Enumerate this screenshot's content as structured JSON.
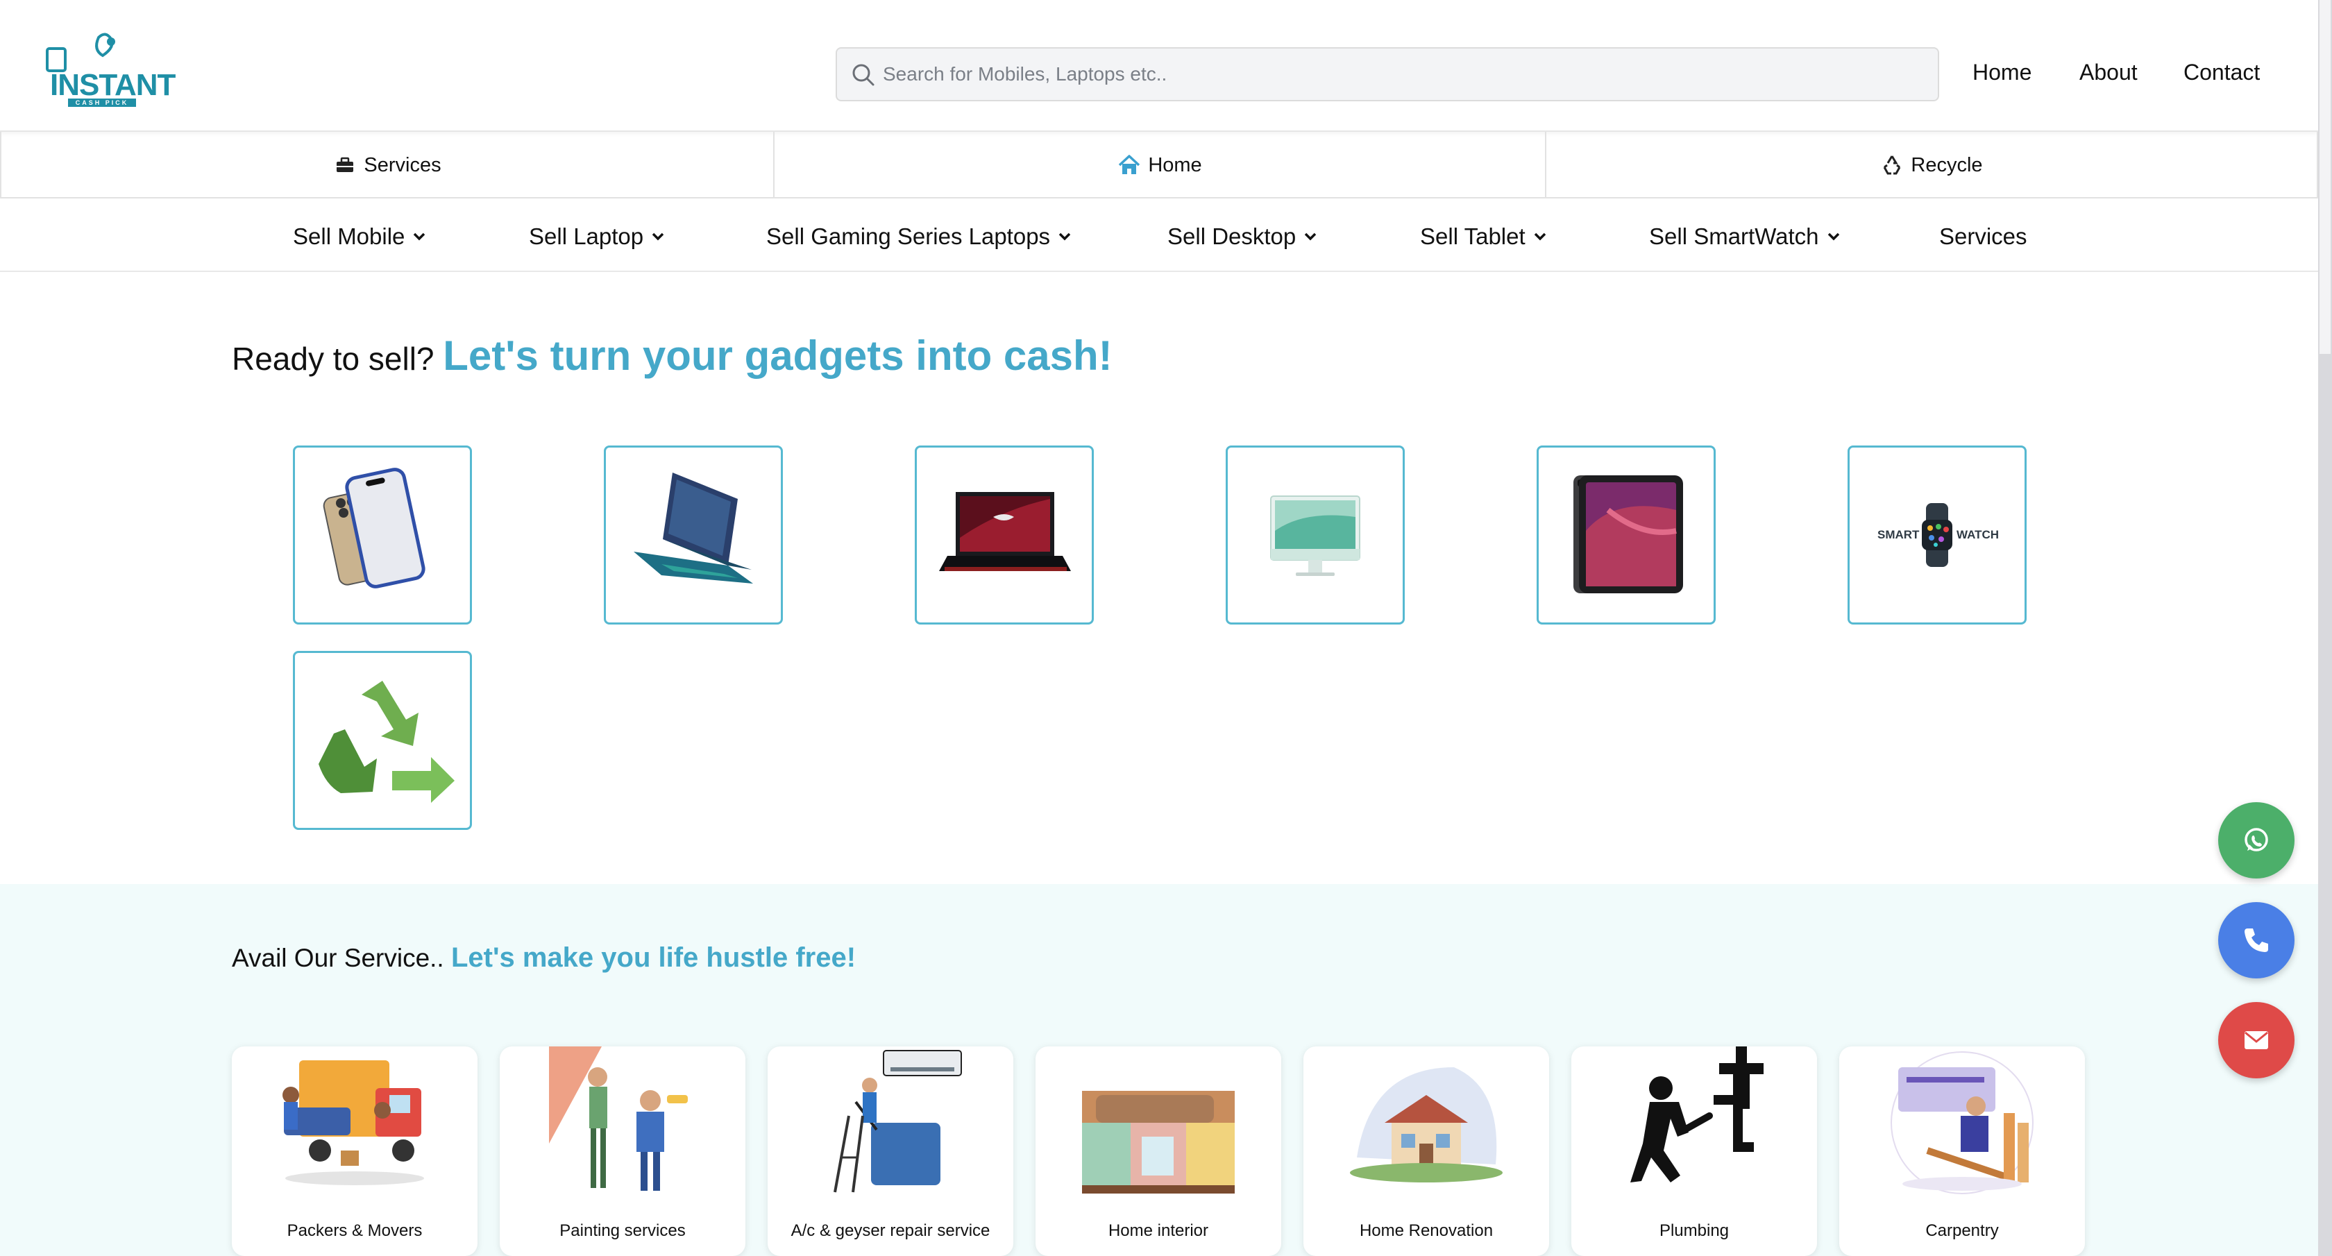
{
  "header": {
    "logo_text": "INSTANT",
    "logo_subtext": "CASH PICK",
    "search_placeholder": "Search for Mobiles, Laptops etc..",
    "nav": [
      "Home",
      "About",
      "Contact"
    ]
  },
  "category_bar": [
    {
      "label": "Services",
      "icon": "toolbox-icon"
    },
    {
      "label": "Home",
      "icon": "home-icon"
    },
    {
      "label": "Recycle",
      "icon": "recycle-icon"
    }
  ],
  "sell_menu": [
    {
      "label": "Sell Mobile",
      "has_dropdown": true
    },
    {
      "label": "Sell Laptop",
      "has_dropdown": true
    },
    {
      "label": "Sell Gaming Series Laptops",
      "has_dropdown": true
    },
    {
      "label": "Sell Desktop",
      "has_dropdown": true
    },
    {
      "label": "Sell Tablet",
      "has_dropdown": true
    },
    {
      "label": "Sell SmartWatch",
      "has_dropdown": true
    },
    {
      "label": "Services",
      "has_dropdown": false
    }
  ],
  "hero": {
    "prefix": "Ready to sell?",
    "accent": "Let's turn your gadgets into cash!"
  },
  "product_tiles": [
    {
      "icon": "smartphone-icon"
    },
    {
      "icon": "laptop-icon"
    },
    {
      "icon": "gaming-laptop-icon"
    },
    {
      "icon": "desktop-icon"
    },
    {
      "icon": "tablet-icon"
    },
    {
      "icon": "smartwatch-icon",
      "text_left": "SMART",
      "text_right": "WATCH"
    },
    {
      "icon": "recycle-icon"
    }
  ],
  "services_section": {
    "prefix": "Avail Our Service..",
    "accent": "Let's make you life hustle free!",
    "items": [
      {
        "label": "Packers & Movers",
        "icon": "moving-truck-icon"
      },
      {
        "label": "Painting services",
        "icon": "painter-icon"
      },
      {
        "label": "A/c & geyser repair service",
        "icon": "ac-repair-icon"
      },
      {
        "label": "Home interior",
        "icon": "interior-icon"
      },
      {
        "label": "Home Renovation",
        "icon": "house-icon"
      },
      {
        "label": "Plumbing",
        "icon": "plumber-icon"
      },
      {
        "label": "Carpentry",
        "icon": "carpenter-icon"
      }
    ]
  },
  "floating_actions": [
    {
      "icon": "whatsapp-icon",
      "color": "#4caf6a"
    },
    {
      "icon": "phone-icon",
      "color": "#4a7fe6"
    },
    {
      "icon": "mail-icon",
      "color": "#df4a48"
    }
  ],
  "colors": {
    "accent": "#45a8c9",
    "tile_border": "#56b9d1",
    "band": "#f1fbfb"
  }
}
